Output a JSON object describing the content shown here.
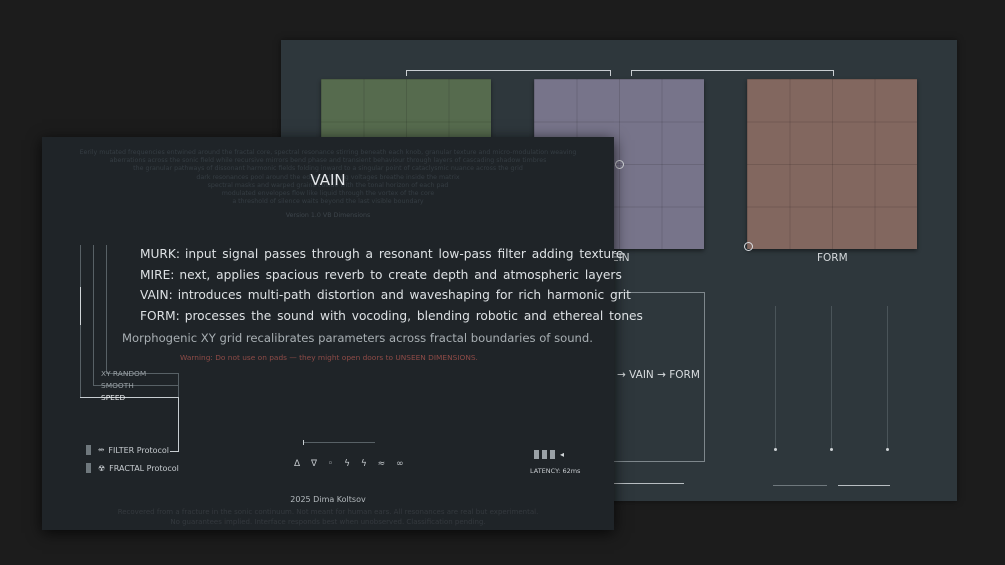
{
  "app": {
    "title": "VAIN",
    "credit": "2025 Dima Koltsov",
    "warning": "Warning: Do not use on pads  —  they might open doors to UNSEEN DIMENSIONS.",
    "morph_text": "Morphogenic XY grid recalibrates parameters across fractal boundaries of sound."
  },
  "modules": [
    {
      "name": "MURK:",
      "desc": "input  signal passes through  a resonant   low-pass filter  adding   texture"
    },
    {
      "name": "MIRE:",
      "desc": "next,  applies  spacious reverb  to  create depth and atmospheric  layers"
    },
    {
      "name": "VAIN:",
      "desc": "introduces multi-path distortion and waveshaping  for rich harmonic grit"
    },
    {
      "name": "FORM:",
      "desc": "processes the sound with vocoding, blending robotic and ethereal tones"
    }
  ],
  "options": {
    "xy_random": "XY RANDOM",
    "smooth": "SMOOTH",
    "speed": "SPEED"
  },
  "protocols": [
    {
      "icon": "⥈",
      "label": "FILTER Protocol"
    },
    {
      "icon": "☢",
      "label": "FRACTAL Protocol"
    }
  ],
  "symbols": "Δ ∇ ◦ ϟ ϟ ≈ ∞",
  "latency": "LATENCY: 62ms",
  "pads": {
    "label_vein": "EIN",
    "label_form": "FORM"
  },
  "chain_text": "→ VAIN → FORM",
  "colors": {
    "pad_murk": "#566b4e",
    "pad_vein": "#77748a",
    "pad_form": "#82675f",
    "warning": "#8e4b47",
    "front_bg": "#1f2428",
    "back_bg": "#2e373c"
  }
}
